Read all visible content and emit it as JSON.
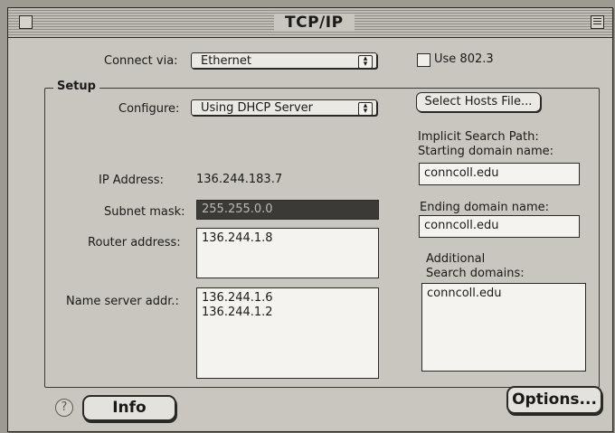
{
  "window": {
    "title": "TCP/IP"
  },
  "connect": {
    "label": "Connect via:",
    "value": "Ethernet"
  },
  "use8023": {
    "label": "Use 802.3",
    "checked": false
  },
  "setup": {
    "group_label": "Setup",
    "configure_label": "Configure:",
    "configure_value": "Using DHCP Server",
    "select_hosts_label": "Select Hosts File...",
    "ip_label": "IP Address:",
    "ip_value": "136.244.183.7",
    "subnet_label": "Subnet mask:",
    "subnet_value": "255.255.0.0",
    "router_label": "Router address:",
    "router_value": "136.244.1.8",
    "ns_label": "Name server addr.:",
    "ns_value": "136.244.1.6\n136.244.1.2",
    "search_path_label": "Implicit Search Path:",
    "starting_domain_label": "Starting domain name:",
    "starting_domain_value": "conncoll.edu",
    "ending_domain_label": "Ending domain name:",
    "ending_domain_value": "conncoll.edu",
    "additional_label": "Additional",
    "search_domains_label": "Search domains:",
    "search_domains_value": "conncoll.edu"
  },
  "footer": {
    "help_glyph": "?",
    "info_label": "Info",
    "options_label": "Options..."
  },
  "icons": {
    "close": "close-box-icon",
    "zoom": "zoom-box-icon",
    "popup_arrow": "up-down-arrow-icon",
    "help": "help-icon"
  }
}
